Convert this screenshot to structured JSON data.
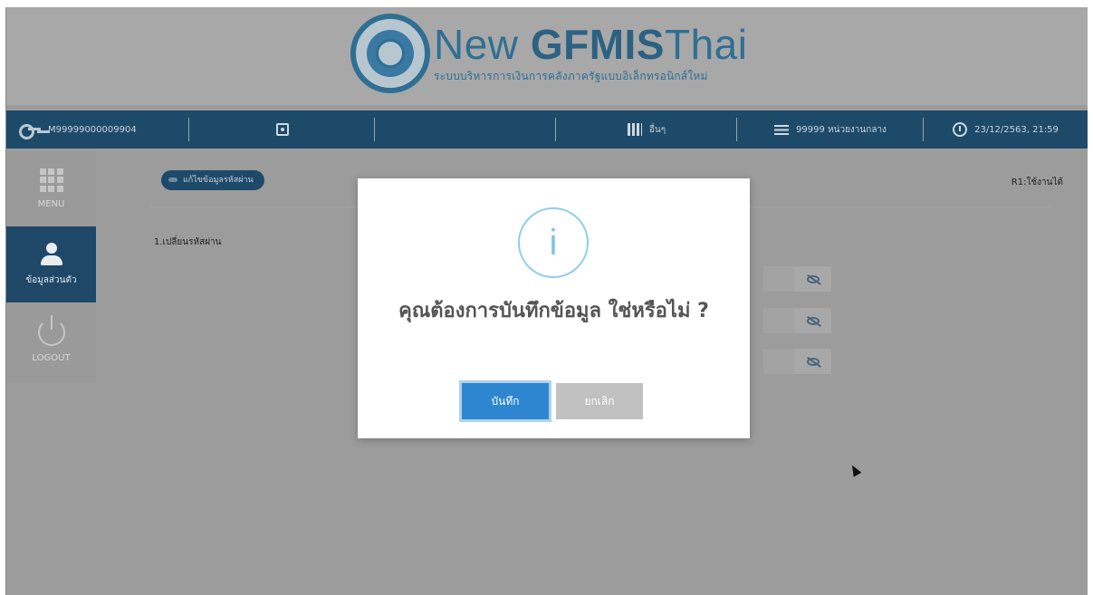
{
  "header": {
    "logo_new": "New ",
    "logo_gfmis": "GFMIS",
    "logo_thai": "Thai",
    "logo_subtitle": "ระบบบริหารการเงินการคลังภาครัฐแบบอิเล็กทรอนิกส์ใหม่"
  },
  "topbar": {
    "user_id": "M99999000009904",
    "other_label": "อื่นๆ",
    "unit_label": "99999 หน่วยงานกลาง",
    "datetime": "23/12/2563, 21:59"
  },
  "sidebar": {
    "items": [
      {
        "label": "MENU"
      },
      {
        "label": "ข้อมูลส่วนตัว"
      },
      {
        "label": "LOGOUT"
      }
    ]
  },
  "content": {
    "tab_label": "แก้ไขข้อมูลรหัสผ่าน",
    "status_text": "R1:ใช้งานได้",
    "section_title": "1.เปลี่ยนรหัสผ่าน"
  },
  "modal": {
    "icon_glyph": "i",
    "message": "คุณต้องการบันทึกข้อมูล ใช่หรือไม่ ?",
    "save_label": "บันทึก",
    "cancel_label": "ยกเลิก"
  },
  "colors": {
    "topbar": "#1e4a6a",
    "primary_button": "#2f86d0",
    "cancel_button": "#c1c1c1",
    "info_icon": "#7ec4e8"
  }
}
